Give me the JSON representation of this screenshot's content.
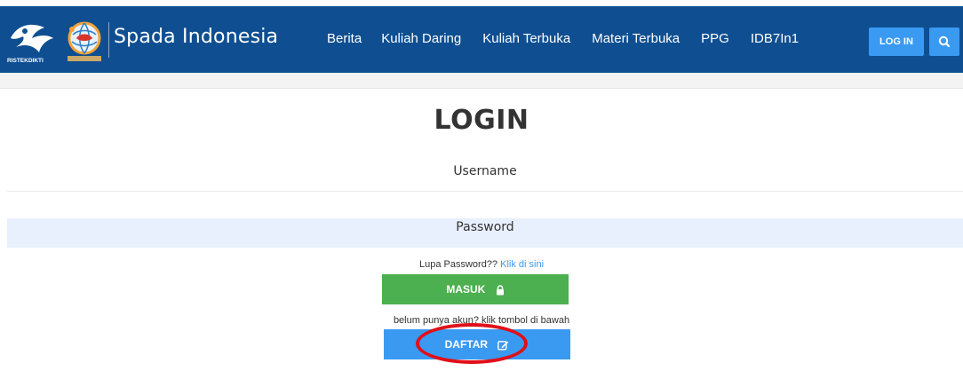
{
  "brand": {
    "ristek_text": "RISTEKDIKTI",
    "name": "Spada Indonesia"
  },
  "nav": {
    "items": [
      "Berita",
      "Kuliah Daring",
      "Kuliah Terbuka",
      "Materi Terbuka",
      "PPG",
      "IDB7In1"
    ],
    "login_label": "LOG IN",
    "search_icon": "search-icon"
  },
  "login": {
    "title": "LOGIN",
    "username_placeholder": "Username",
    "password_placeholder": "Password",
    "forgot_text": "Lupa Password??",
    "forgot_link": "Klik di sini",
    "masuk_label": "MASUK",
    "masuk_icon": "lock-icon",
    "register_hint": "belum punya akun? klik tombol di bawah",
    "daftar_label": "DAFTAR",
    "daftar_icon": "edit-icon"
  },
  "colors": {
    "navbar": "#0f4f91",
    "accent_blue": "#3a9af2",
    "masuk_green": "#4caf50",
    "highlight_red": "#e0101a",
    "autofill": "#e8f0fe"
  }
}
